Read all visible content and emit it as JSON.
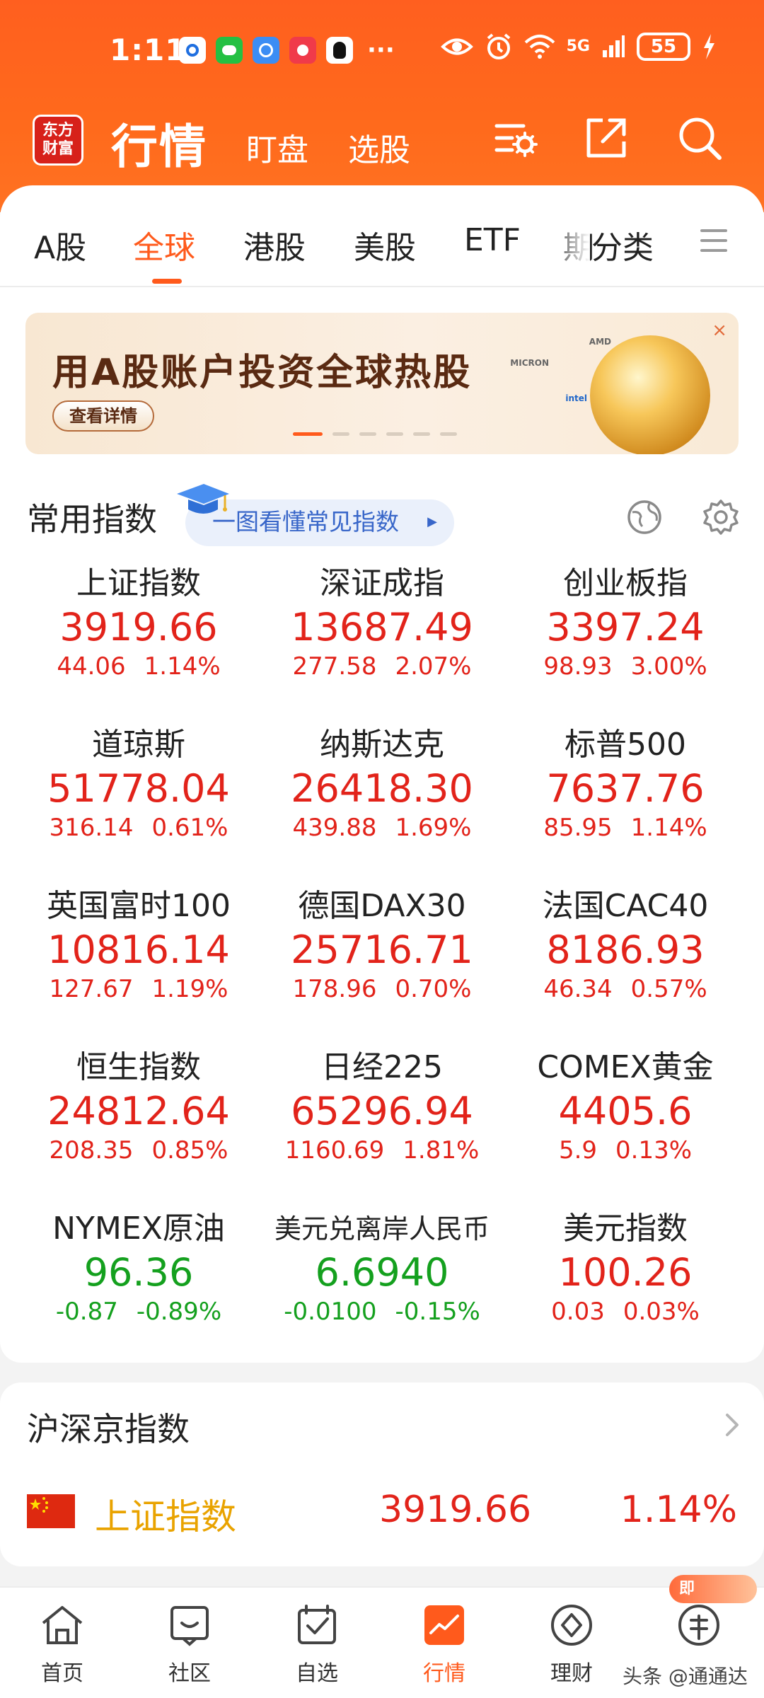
{
  "status_bar": {
    "time": "1:11",
    "notification_icons": [
      "qq-browser-icon",
      "wechat-icon",
      "browser-icon",
      "app-icon",
      "qq-icon"
    ],
    "more": "···",
    "network": "5G",
    "battery": "55"
  },
  "header": {
    "logo_line1": "东方",
    "logo_line2": "财富",
    "title": "行情",
    "tab1": "盯盘",
    "tab2": "选股"
  },
  "market_tabs": {
    "items": [
      "A股",
      "全球",
      "港股",
      "美股",
      "ETF",
      "期",
      "分类"
    ],
    "active": "全球"
  },
  "banner": {
    "title": "用A股账户投资全球热股",
    "button": "查看详情",
    "close": "×",
    "brands": [
      "AMD",
      "MICRON",
      "intel"
    ],
    "slides": 6,
    "active_slide": 1
  },
  "common_indices": {
    "title": "常用指数",
    "guide": "一图看懂常见指数",
    "guide_arrow": "▶"
  },
  "indices": [
    {
      "name": "上证指数",
      "price": "3919.66",
      "change": "44.06",
      "pct": "1.14%",
      "dir": "up"
    },
    {
      "name": "深证成指",
      "price": "13687.49",
      "change": "277.58",
      "pct": "2.07%",
      "dir": "up"
    },
    {
      "name": "创业板指",
      "price": "3397.24",
      "change": "98.93",
      "pct": "3.00%",
      "dir": "up"
    },
    {
      "name": "道琼斯",
      "price": "51778.04",
      "change": "316.14",
      "pct": "0.61%",
      "dir": "up"
    },
    {
      "name": "纳斯达克",
      "price": "26418.30",
      "change": "439.88",
      "pct": "1.69%",
      "dir": "up"
    },
    {
      "name": "标普500",
      "price": "7637.76",
      "change": "85.95",
      "pct": "1.14%",
      "dir": "up"
    },
    {
      "name": "英国富时100",
      "price": "10816.14",
      "change": "127.67",
      "pct": "1.19%",
      "dir": "up"
    },
    {
      "name": "德国DAX30",
      "price": "25716.71",
      "change": "178.96",
      "pct": "0.70%",
      "dir": "up"
    },
    {
      "name": "法国CAC40",
      "price": "8186.93",
      "change": "46.34",
      "pct": "0.57%",
      "dir": "up"
    },
    {
      "name": "恒生指数",
      "price": "24812.64",
      "change": "208.35",
      "pct": "0.85%",
      "dir": "up"
    },
    {
      "name": "日经225",
      "price": "65296.94",
      "change": "1160.69",
      "pct": "1.81%",
      "dir": "up"
    },
    {
      "name": "COMEX黄金",
      "price": "4405.6",
      "change": "5.9",
      "pct": "0.13%",
      "dir": "up"
    },
    {
      "name": "NYMEX原油",
      "price": "96.36",
      "change": "-0.87",
      "pct": "-0.89%",
      "dir": "down"
    },
    {
      "name": "美元兑离岸人民币",
      "price": "6.6940",
      "change": "-0.0100",
      "pct": "-0.15%",
      "dir": "down"
    },
    {
      "name": "美元指数",
      "price": "100.26",
      "change": "0.03",
      "pct": "0.03%",
      "dir": "up"
    }
  ],
  "hs_indices": {
    "title": "沪深京指数",
    "row": {
      "name": "上证指数",
      "price": "3919.66",
      "pct": "1.14%"
    }
  },
  "bottom_nav": {
    "items": [
      "首页",
      "社区",
      "自选",
      "行情",
      "理财",
      "开户"
    ],
    "active": "行情",
    "badge": "即",
    "watermark": "头条 @通通达"
  },
  "colors": {
    "brand": "#ff5f1f",
    "up": "#e2231a",
    "down": "#14a01e",
    "accent": "#ff5a1c"
  }
}
